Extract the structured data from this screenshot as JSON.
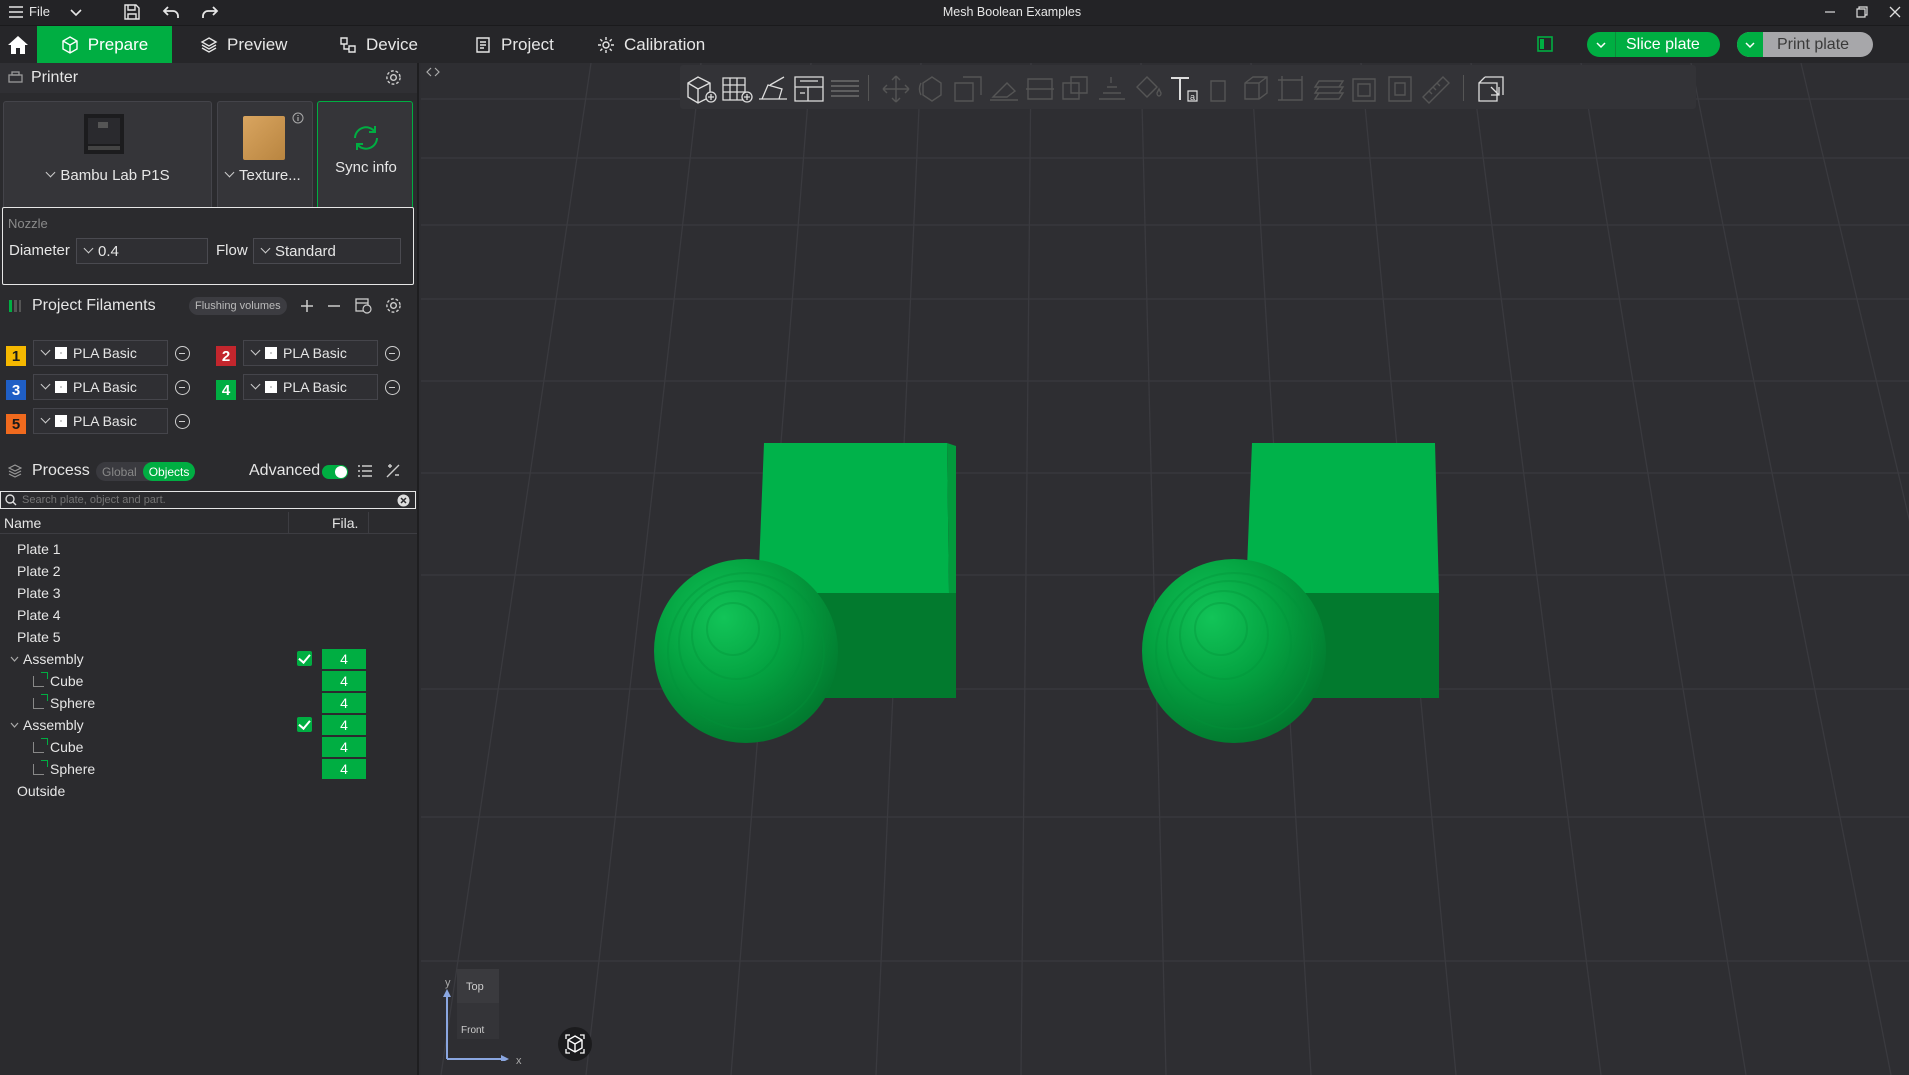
{
  "window": {
    "title": "Mesh Boolean Examples",
    "menu_label": "File"
  },
  "tabs": [
    {
      "label": "Prepare",
      "icon": "cube-icon",
      "active": true
    },
    {
      "label": "Preview",
      "icon": "layers-icon"
    },
    {
      "label": "Device",
      "icon": "device-icon"
    },
    {
      "label": "Project",
      "icon": "project-icon"
    },
    {
      "label": "Calibration",
      "icon": "calibration-icon"
    }
  ],
  "actions": {
    "slice_label": "Slice plate",
    "print_label": "Print plate"
  },
  "printer": {
    "section_title": "Printer",
    "printer_name": "Bambu Lab P1S",
    "plate_name": "Texture...",
    "sync_label": "Sync info"
  },
  "nozzle": {
    "title": "Nozzle",
    "diameter_label": "Diameter",
    "diameter_value": "0.4",
    "flow_label": "Flow",
    "flow_value": "Standard"
  },
  "filaments": {
    "title": "Project Filaments",
    "flushing_label": "Flushing volumes",
    "items": [
      {
        "index": "1",
        "name": "PLA Basic",
        "color": "#f5b800"
      },
      {
        "index": "2",
        "name": "PLA Basic",
        "color": "#c3262d"
      },
      {
        "index": "3",
        "name": "PLA Basic",
        "color": "#1f5fc6"
      },
      {
        "index": "4",
        "name": "PLA Basic",
        "color": "#00ae42"
      },
      {
        "index": "5",
        "name": "PLA Basic",
        "color": "#f06a1e"
      }
    ]
  },
  "process": {
    "title": "Process",
    "global_label": "Global",
    "objects_label": "Objects",
    "advanced_label": "Advanced",
    "search_placeholder": "Search plate, object and part."
  },
  "object_list": {
    "col_name": "Name",
    "col_fila": "Fila.",
    "rows": [
      {
        "label": "Plate 1",
        "level": 0,
        "type": "plate"
      },
      {
        "label": "Plate 2",
        "level": 0,
        "type": "plate"
      },
      {
        "label": "Plate 3",
        "level": 0,
        "type": "plate"
      },
      {
        "label": "Plate 4",
        "level": 0,
        "type": "plate"
      },
      {
        "label": "Plate 5",
        "level": 0,
        "type": "plate"
      },
      {
        "label": "Assembly",
        "level": 1,
        "type": "assembly",
        "fila": "4"
      },
      {
        "label": "Cube",
        "level": 2,
        "type": "part",
        "fila": "4"
      },
      {
        "label": "Sphere",
        "level": 2,
        "type": "part",
        "fila": "4"
      },
      {
        "label": "Assembly",
        "level": 1,
        "type": "assembly",
        "fila": "4"
      },
      {
        "label": "Cube",
        "level": 2,
        "type": "part",
        "fila": "4"
      },
      {
        "label": "Sphere",
        "level": 2,
        "type": "part",
        "fila": "4"
      },
      {
        "label": "Outside",
        "level": 0,
        "type": "plate"
      }
    ]
  },
  "axes": {
    "top_label": "Top",
    "front_label": "Front",
    "y_label": "y",
    "x_label": "x"
  },
  "colors": {
    "accent": "#00ae42",
    "model": "#00b34a"
  }
}
